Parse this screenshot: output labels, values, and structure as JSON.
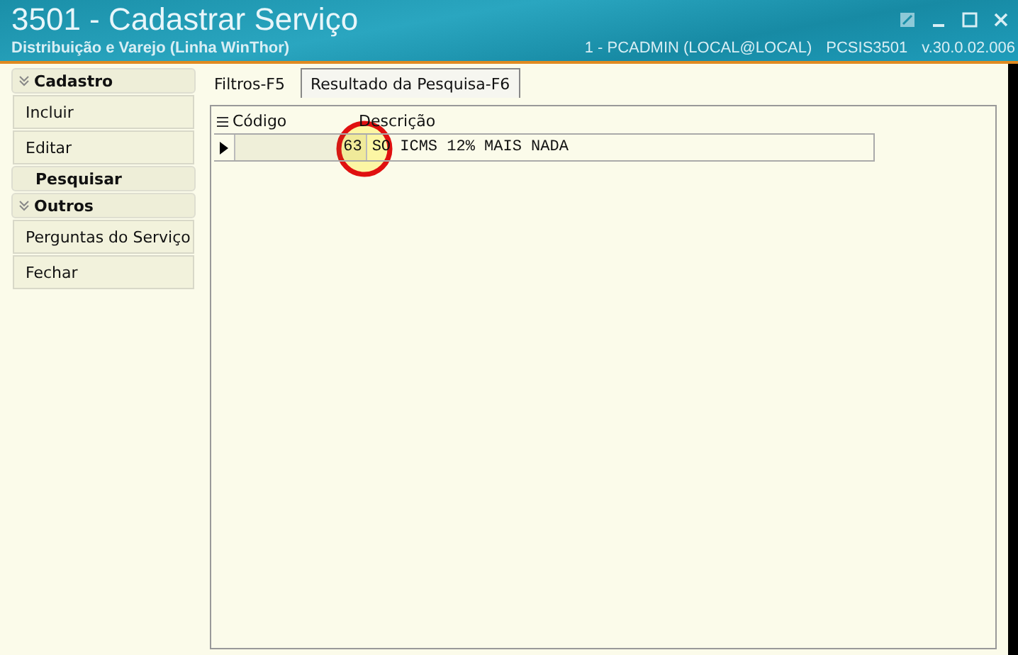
{
  "window": {
    "title": "3501 - Cadastrar Serviço",
    "subtitle": "Distribuição e Varejo (Linha WinThor)",
    "session": "1 - PCADMIN (LOCAL@LOCAL)",
    "program": "PCSIS3501",
    "version": "v.30.0.02.006"
  },
  "sidebar": {
    "groups": [
      {
        "title": "Cadastro",
        "kind": "collapsible",
        "items": [
          "Incluir",
          "Editar"
        ]
      },
      {
        "title": "Pesquisar",
        "kind": "plain"
      },
      {
        "title": "Outros",
        "kind": "collapsible",
        "items": [
          "Perguntas do Serviço",
          "Fechar"
        ]
      }
    ]
  },
  "tabs": [
    {
      "label": "Filtros-F5",
      "selected": false
    },
    {
      "label": "Resultado da Pesquisa-F6",
      "selected": true
    }
  ],
  "table": {
    "columns": [
      "Código",
      "Descrição"
    ],
    "rows": [
      {
        "code": "63",
        "description": "SO ICMS 12% MAIS NADA",
        "selected": true
      }
    ]
  },
  "click_marker": {
    "kind": "circle"
  }
}
